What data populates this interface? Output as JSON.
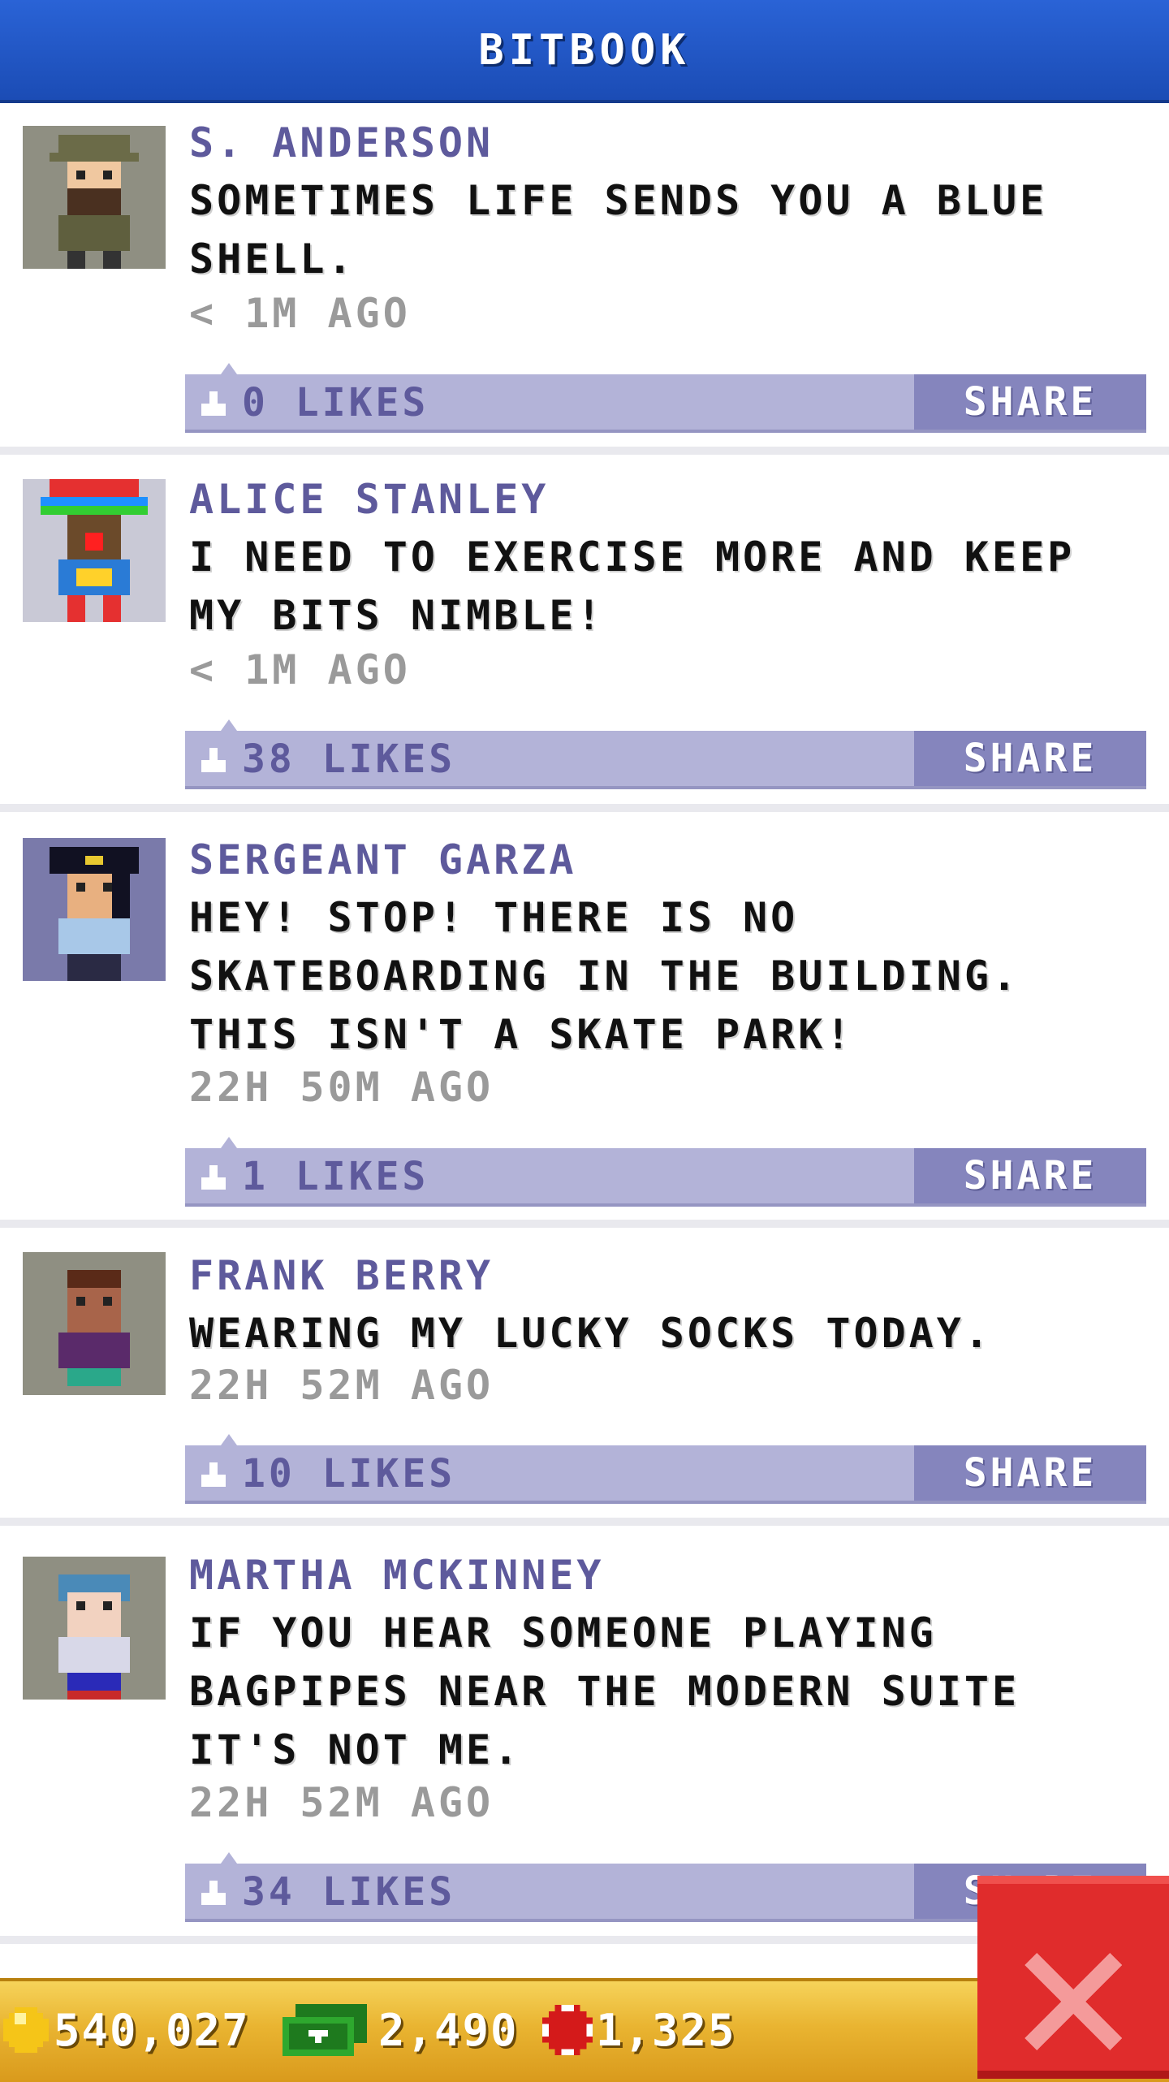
{
  "header": {
    "title": "BITBOOK"
  },
  "posts": [
    {
      "name": "S. ANDERSON",
      "text": "SOMETIMES LIFE SENDS YOU A BLUE SHELL.",
      "time": "< 1M AGO",
      "likes": "0 LIKES",
      "share": "SHARE"
    },
    {
      "name": "ALICE STANLEY",
      "text": "I NEED TO EXERCISE MORE AND KEEP MY BITS NIMBLE!",
      "time": "< 1M AGO",
      "likes": "38 LIKES",
      "share": "SHARE"
    },
    {
      "name": "SERGEANT GARZA",
      "text": "HEY! STOP! THERE IS NO SKATEBOARDING IN THE BUILDING. THIS ISN'T A SKATE PARK!",
      "time": "22H 50M AGO",
      "likes": "1 LIKES",
      "share": "SHARE"
    },
    {
      "name": "FRANK BERRY",
      "text": "WEARING MY LUCKY SOCKS TODAY.",
      "time": "22H 52M AGO",
      "likes": "10 LIKES",
      "share": "SHARE"
    },
    {
      "name": "MARTHA MCKINNEY",
      "text": "IF YOU HEAR SOMEONE PLAYING BAGPIPES NEAR THE MODERN SUITE IT'S NOT ME.",
      "time": "22H 52M AGO",
      "likes": "34 LIKES",
      "share": "SHARE"
    }
  ],
  "status_bar": {
    "coins": "540,027",
    "cash": "2,490",
    "bux": "1,325"
  },
  "icons": {
    "close": "close-x-icon",
    "like": "thumbs-up-icon",
    "coin": "coin-icon",
    "cash": "cash-icon",
    "bux": "bux-icon"
  },
  "colors": {
    "header": "#1b4cb5",
    "like_bar": "#b3b3d8",
    "share_button": "#8585bd",
    "name_text": "#5e5a9c",
    "bottom_bar": "#e9b431",
    "close_button": "#e02c2c"
  }
}
